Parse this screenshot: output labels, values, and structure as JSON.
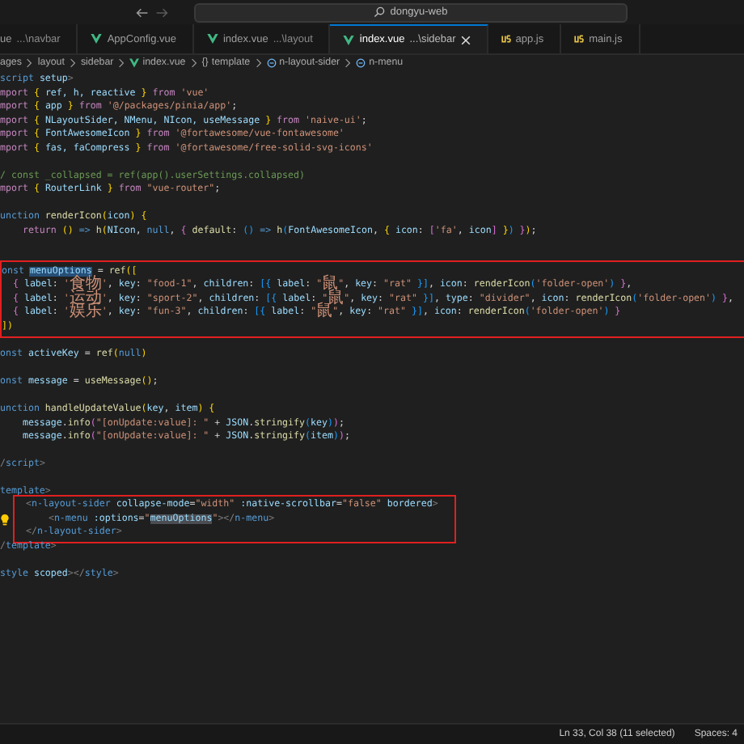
{
  "titlebar": {
    "search": "dongyu-web"
  },
  "tabs": [
    {
      "label": "ue",
      "detail": "...\\navbar",
      "kind": "plain",
      "selected": false
    },
    {
      "label": "AppConfig.vue",
      "kind": "vue",
      "selected": false
    },
    {
      "label": "index.vue",
      "detail": "...\\layout",
      "kind": "vue",
      "selected": false
    },
    {
      "label": "index.vue",
      "detail": "...\\sidebar",
      "kind": "vue",
      "selected": true
    },
    {
      "label": "app.js",
      "kind": "js",
      "selected": false
    },
    {
      "label": "main.js",
      "kind": "js",
      "selected": false
    }
  ],
  "breadcrumb": [
    {
      "kind": "plain",
      "text": "ages"
    },
    {
      "kind": "plain",
      "text": "layout"
    },
    {
      "kind": "plain",
      "text": "sidebar"
    },
    {
      "kind": "vue",
      "text": "index.vue"
    },
    {
      "kind": "braces",
      "glyph": "{}",
      "text": "template"
    },
    {
      "kind": "component",
      "text": "n-layout-sider"
    },
    {
      "kind": "component",
      "text": "n-menu"
    }
  ],
  "code": [
    {
      "lines": [
        {
          "kind": "code",
          "parts": [
            {
              "kind": "k",
              "text": "script "
            },
            {
              "kind": "v",
              "text": "setup"
            },
            {
              "kind": "t",
              "text": ">"
            }
          ]
        },
        {
          "kind": "code",
          "parts": [
            {
              "kind": "m",
              "text": "mport "
            },
            {
              "kind": "b",
              "text": "{ "
            },
            {
              "kind": "v",
              "text": "ref, h, reactive "
            },
            {
              "kind": "b",
              "text": "} "
            },
            {
              "kind": "m",
              "text": "from "
            },
            {
              "kind": "s",
              "text": "'vue'"
            }
          ]
        },
        {
          "kind": "code",
          "parts": [
            {
              "kind": "m",
              "text": "mport "
            },
            {
              "kind": "b",
              "text": "{ "
            },
            {
              "kind": "v",
              "text": "app "
            },
            {
              "kind": "b",
              "text": "} "
            },
            {
              "kind": "m",
              "text": "from "
            },
            {
              "kind": "s",
              "text": "'@/packages/pinia/app'"
            },
            {
              "kind": "p",
              "text": ";"
            }
          ]
        },
        {
          "kind": "code",
          "parts": [
            {
              "kind": "m",
              "text": "mport "
            },
            {
              "kind": "b",
              "text": "{ "
            },
            {
              "kind": "v",
              "text": "NLayoutSider, NMenu, NIcon, useMessage "
            },
            {
              "kind": "b",
              "text": "} "
            },
            {
              "kind": "m",
              "text": "from "
            },
            {
              "kind": "s",
              "text": "'naive-ui'"
            },
            {
              "kind": "p",
              "text": ";"
            }
          ]
        },
        {
          "kind": "code",
          "parts": [
            {
              "kind": "m",
              "text": "mport "
            },
            {
              "kind": "b",
              "text": "{ "
            },
            {
              "kind": "v",
              "text": "FontAwesomeIcon "
            },
            {
              "kind": "b",
              "text": "} "
            },
            {
              "kind": "m",
              "text": "from "
            },
            {
              "kind": "s",
              "text": "'@fortawesome/vue-fontawesome'"
            }
          ]
        },
        {
          "kind": "code",
          "parts": [
            {
              "kind": "m",
              "text": "mport "
            },
            {
              "kind": "b",
              "text": "{ "
            },
            {
              "kind": "v",
              "text": "fas, faCompress "
            },
            {
              "kind": "b",
              "text": "} "
            },
            {
              "kind": "m",
              "text": "from "
            },
            {
              "kind": "s",
              "text": "'@fortawesome/free-solid-svg-icons'"
            }
          ]
        },
        {
          "kind": "blank"
        },
        {
          "kind": "code",
          "parts": [
            {
              "kind": "c",
              "text": "/ const _collapsed = ref(app().userSettings.collapsed)"
            }
          ]
        },
        {
          "kind": "code",
          "parts": [
            {
              "kind": "m",
              "text": "mport "
            },
            {
              "kind": "b",
              "text": "{ "
            },
            {
              "kind": "v",
              "text": "RouterLink "
            },
            {
              "kind": "b",
              "text": "} "
            },
            {
              "kind": "m",
              "text": "from "
            },
            {
              "kind": "s",
              "text": "\"vue-router\""
            },
            {
              "kind": "p",
              "text": ";"
            }
          ]
        },
        {
          "kind": "blank"
        },
        {
          "kind": "code",
          "parts": [
            {
              "kind": "k",
              "text": "unction "
            },
            {
              "kind": "f",
              "text": "renderIcon"
            },
            {
              "kind": "b",
              "text": "("
            },
            {
              "kind": "v",
              "text": "icon"
            },
            {
              "kind": "b",
              "text": ") {"
            }
          ]
        },
        {
          "kind": "code",
          "parts": [
            {
              "kind": "m",
              "text": "    return "
            },
            {
              "kind": "b",
              "text": "() "
            },
            {
              "kind": "k",
              "text": "=> "
            },
            {
              "kind": "f",
              "text": "h"
            },
            {
              "kind": "b",
              "text": "("
            },
            {
              "kind": "v",
              "text": "NIcon"
            },
            {
              "kind": "p",
              "text": ", "
            },
            {
              "kind": "k",
              "text": "null"
            },
            {
              "kind": "p",
              "text": ", "
            },
            {
              "kind": "b2",
              "text": "{ "
            },
            {
              "kind": "f",
              "text": "default"
            },
            {
              "kind": "p",
              "text": ": "
            },
            {
              "kind": "b3",
              "text": "() "
            },
            {
              "kind": "k",
              "text": "=> "
            },
            {
              "kind": "f",
              "text": "h"
            },
            {
              "kind": "b3",
              "text": "("
            },
            {
              "kind": "v",
              "text": "FontAwesomeIcon"
            },
            {
              "kind": "p",
              "text": ", "
            },
            {
              "kind": "b",
              "text": "{ "
            },
            {
              "kind": "v",
              "text": "icon"
            },
            {
              "kind": "p",
              "text": ": "
            },
            {
              "kind": "b2",
              "text": "["
            },
            {
              "kind": "s",
              "text": "'fa'"
            },
            {
              "kind": "p",
              "text": ", "
            },
            {
              "kind": "v",
              "text": "icon"
            },
            {
              "kind": "b2",
              "text": "]"
            },
            {
              "kind": "b",
              "text": " }"
            },
            {
              "kind": "b3",
              "text": ")"
            },
            {
              "kind": "b2",
              "text": " }"
            },
            {
              "kind": "b",
              "text": ")"
            },
            {
              "kind": "p",
              "text": ";"
            }
          ]
        },
        {
          "kind": "blank"
        },
        {
          "kind": "blank"
        }
      ]
    },
    {
      "annotated": true,
      "lines": [
        {
          "kind": "code",
          "parts": [
            {
              "kind": "k",
              "text": "onst "
            },
            {
              "kind": "sel",
              "text": "menuOptions"
            },
            {
              "kind": "p",
              "text": " = "
            },
            {
              "kind": "f",
              "text": "ref"
            },
            {
              "kind": "b",
              "text": "(["
            }
          ]
        },
        {
          "kind": "code",
          "parts": [
            {
              "kind": "b2",
              "text": "  { "
            },
            {
              "kind": "v",
              "text": "label"
            },
            {
              "kind": "p",
              "text": ": "
            },
            {
              "kind": "s",
              "text": "'"
            },
            {
              "kind": "sc",
              "text": "食物"
            },
            {
              "kind": "s",
              "text": "'"
            },
            {
              "kind": "p",
              "text": ", "
            },
            {
              "kind": "v",
              "text": "key"
            },
            {
              "kind": "p",
              "text": ": "
            },
            {
              "kind": "s",
              "text": "\"food-1\""
            },
            {
              "kind": "p",
              "text": ", "
            },
            {
              "kind": "v",
              "text": "children"
            },
            {
              "kind": "p",
              "text": ": "
            },
            {
              "kind": "b3",
              "text": "[{ "
            },
            {
              "kind": "v",
              "text": "label"
            },
            {
              "kind": "p",
              "text": ": "
            },
            {
              "kind": "s",
              "text": "\""
            },
            {
              "kind": "sc",
              "text": "鼠"
            },
            {
              "kind": "s",
              "text": "\""
            },
            {
              "kind": "p",
              "text": ", "
            },
            {
              "kind": "v",
              "text": "key"
            },
            {
              "kind": "p",
              "text": ": "
            },
            {
              "kind": "s",
              "text": "\"rat\""
            },
            {
              "kind": "b3",
              "text": " }]"
            },
            {
              "kind": "p",
              "text": ", "
            },
            {
              "kind": "v",
              "text": "icon"
            },
            {
              "kind": "p",
              "text": ": "
            },
            {
              "kind": "f",
              "text": "renderIcon"
            },
            {
              "kind": "b3",
              "text": "("
            },
            {
              "kind": "s",
              "text": "'folder-open'"
            },
            {
              "kind": "b3",
              "text": ")"
            },
            {
              "kind": "b2",
              "text": " }"
            },
            {
              "kind": "p",
              "text": ","
            }
          ]
        },
        {
          "kind": "code",
          "parts": [
            {
              "kind": "b2",
              "text": "  { "
            },
            {
              "kind": "v",
              "text": "label"
            },
            {
              "kind": "p",
              "text": ": "
            },
            {
              "kind": "s",
              "text": "'"
            },
            {
              "kind": "sc",
              "text": "运动"
            },
            {
              "kind": "s",
              "text": "'"
            },
            {
              "kind": "p",
              "text": ", "
            },
            {
              "kind": "v",
              "text": "key"
            },
            {
              "kind": "p",
              "text": ": "
            },
            {
              "kind": "s",
              "text": "\"sport-2\""
            },
            {
              "kind": "p",
              "text": ", "
            },
            {
              "kind": "v",
              "text": "children"
            },
            {
              "kind": "p",
              "text": ": "
            },
            {
              "kind": "b3",
              "text": "[{ "
            },
            {
              "kind": "v",
              "text": "label"
            },
            {
              "kind": "p",
              "text": ": "
            },
            {
              "kind": "s",
              "text": "\""
            },
            {
              "kind": "sc",
              "text": "鼠"
            },
            {
              "kind": "s",
              "text": "\""
            },
            {
              "kind": "p",
              "text": ", "
            },
            {
              "kind": "v",
              "text": "key"
            },
            {
              "kind": "p",
              "text": ": "
            },
            {
              "kind": "s",
              "text": "\"rat\""
            },
            {
              "kind": "b3",
              "text": " }]"
            },
            {
              "kind": "p",
              "text": ", "
            },
            {
              "kind": "v",
              "text": "type"
            },
            {
              "kind": "p",
              "text": ": "
            },
            {
              "kind": "s",
              "text": "\"divider\""
            },
            {
              "kind": "p",
              "text": ", "
            },
            {
              "kind": "v",
              "text": "icon"
            },
            {
              "kind": "p",
              "text": ": "
            },
            {
              "kind": "f",
              "text": "renderIcon"
            },
            {
              "kind": "b3",
              "text": "("
            },
            {
              "kind": "s",
              "text": "'folder-open'"
            },
            {
              "kind": "b3",
              "text": ")"
            },
            {
              "kind": "b2",
              "text": " }"
            },
            {
              "kind": "p",
              "text": ","
            }
          ]
        },
        {
          "kind": "code",
          "parts": [
            {
              "kind": "b2",
              "text": "  { "
            },
            {
              "kind": "v",
              "text": "label"
            },
            {
              "kind": "p",
              "text": ": "
            },
            {
              "kind": "s",
              "text": "'"
            },
            {
              "kind": "sc",
              "text": "娱乐"
            },
            {
              "kind": "s",
              "text": "'"
            },
            {
              "kind": "p",
              "text": ", "
            },
            {
              "kind": "v",
              "text": "key"
            },
            {
              "kind": "p",
              "text": ": "
            },
            {
              "kind": "s",
              "text": "\"fun-3\""
            },
            {
              "kind": "p",
              "text": ", "
            },
            {
              "kind": "v",
              "text": "children"
            },
            {
              "kind": "p",
              "text": ": "
            },
            {
              "kind": "b3",
              "text": "[{ "
            },
            {
              "kind": "v",
              "text": "label"
            },
            {
              "kind": "p",
              "text": ": "
            },
            {
              "kind": "s",
              "text": "\""
            },
            {
              "kind": "sc",
              "text": "鼠"
            },
            {
              "kind": "s",
              "text": "\""
            },
            {
              "kind": "p",
              "text": ", "
            },
            {
              "kind": "v",
              "text": "key"
            },
            {
              "kind": "p",
              "text": ": "
            },
            {
              "kind": "s",
              "text": "\"rat\""
            },
            {
              "kind": "b3",
              "text": " }]"
            },
            {
              "kind": "p",
              "text": ", "
            },
            {
              "kind": "v",
              "text": "icon"
            },
            {
              "kind": "p",
              "text": ": "
            },
            {
              "kind": "f",
              "text": "renderIcon"
            },
            {
              "kind": "b3",
              "text": "("
            },
            {
              "kind": "s",
              "text": "'folder-open'"
            },
            {
              "kind": "b3",
              "text": ")"
            },
            {
              "kind": "b2",
              "text": " }"
            }
          ]
        },
        {
          "kind": "code",
          "parts": [
            {
              "kind": "b",
              "text": "])"
            }
          ]
        }
      ]
    },
    {
      "lines": [
        {
          "kind": "blank"
        },
        {
          "kind": "code",
          "parts": [
            {
              "kind": "k",
              "text": "onst "
            },
            {
              "kind": "v",
              "text": "activeKey"
            },
            {
              "kind": "p",
              "text": " = "
            },
            {
              "kind": "f",
              "text": "ref"
            },
            {
              "kind": "b",
              "text": "("
            },
            {
              "kind": "k",
              "text": "null"
            },
            {
              "kind": "b",
              "text": ")"
            }
          ]
        },
        {
          "kind": "blank"
        },
        {
          "kind": "code",
          "parts": [
            {
              "kind": "k",
              "text": "onst "
            },
            {
              "kind": "v",
              "text": "message"
            },
            {
              "kind": "p",
              "text": " = "
            },
            {
              "kind": "f",
              "text": "useMessage"
            },
            {
              "kind": "b",
              "text": "()"
            },
            {
              "kind": "p",
              "text": ";"
            }
          ]
        },
        {
          "kind": "blank"
        },
        {
          "kind": "code",
          "parts": [
            {
              "kind": "k",
              "text": "unction "
            },
            {
              "kind": "f",
              "text": "handleUpdateValue"
            },
            {
              "kind": "b",
              "text": "("
            },
            {
              "kind": "v",
              "text": "key"
            },
            {
              "kind": "p",
              "text": ", "
            },
            {
              "kind": "v",
              "text": "item"
            },
            {
              "kind": "b",
              "text": ") {"
            }
          ]
        },
        {
          "kind": "code",
          "parts": [
            {
              "kind": "v",
              "text": "    message"
            },
            {
              "kind": "p",
              "text": "."
            },
            {
              "kind": "f",
              "text": "info"
            },
            {
              "kind": "b2",
              "text": "("
            },
            {
              "kind": "s",
              "text": "\"[onUpdate:value]: \""
            },
            {
              "kind": "p",
              "text": " + "
            },
            {
              "kind": "v",
              "text": "JSON"
            },
            {
              "kind": "p",
              "text": "."
            },
            {
              "kind": "f",
              "text": "stringify"
            },
            {
              "kind": "b3",
              "text": "("
            },
            {
              "kind": "v",
              "text": "key"
            },
            {
              "kind": "b3",
              "text": ")"
            },
            {
              "kind": "b2",
              "text": ")"
            },
            {
              "kind": "p",
              "text": ";"
            }
          ]
        },
        {
          "kind": "code",
          "parts": [
            {
              "kind": "v",
              "text": "    message"
            },
            {
              "kind": "p",
              "text": "."
            },
            {
              "kind": "f",
              "text": "info"
            },
            {
              "kind": "b2",
              "text": "("
            },
            {
              "kind": "s",
              "text": "\"[onUpdate:value]: \""
            },
            {
              "kind": "p",
              "text": " + "
            },
            {
              "kind": "v",
              "text": "JSON"
            },
            {
              "kind": "p",
              "text": "."
            },
            {
              "kind": "f",
              "text": "stringify"
            },
            {
              "kind": "b3",
              "text": "("
            },
            {
              "kind": "v",
              "text": "item"
            },
            {
              "kind": "b3",
              "text": ")"
            },
            {
              "kind": "b2",
              "text": ")"
            },
            {
              "kind": "p",
              "text": ";"
            }
          ]
        },
        {
          "kind": "blank"
        },
        {
          "kind": "code",
          "parts": [
            {
              "kind": "t",
              "text": "/"
            },
            {
              "kind": "k",
              "text": "script"
            },
            {
              "kind": "t",
              "text": ">"
            }
          ]
        },
        {
          "kind": "blank"
        },
        {
          "kind": "code",
          "parts": [
            {
              "kind": "k",
              "text": "template"
            },
            {
              "kind": "t",
              "text": ">"
            }
          ]
        }
      ]
    },
    {
      "annotated": true,
      "lines": [
        {
          "kind": "code",
          "parts": [
            {
              "kind": "t",
              "text": "  <"
            },
            {
              "kind": "k",
              "text": "n-layout-sider"
            },
            {
              "kind": "v",
              "text": " collapse-mode"
            },
            {
              "kind": "p",
              "text": "="
            },
            {
              "kind": "s",
              "text": "\"width\""
            },
            {
              "kind": "v",
              "text": " :native-scrollbar"
            },
            {
              "kind": "p",
              "text": "="
            },
            {
              "kind": "s",
              "text": "\"false\""
            },
            {
              "kind": "v",
              "text": " bordered"
            },
            {
              "kind": "t",
              "text": ">"
            }
          ]
        },
        {
          "kind": "code",
          "lightbulb": true,
          "parts": [
            {
              "kind": "t",
              "text": "      <"
            },
            {
              "kind": "k",
              "text": "n-menu"
            },
            {
              "kind": "v",
              "text": " :options"
            },
            {
              "kind": "p",
              "text": "="
            },
            {
              "kind": "s",
              "text": "\""
            },
            {
              "kind": "hl",
              "text": "menuOptions"
            },
            {
              "kind": "s",
              "text": "\""
            },
            {
              "kind": "t",
              "text": "></"
            },
            {
              "kind": "k",
              "text": "n-menu"
            },
            {
              "kind": "t",
              "text": ">"
            }
          ]
        },
        {
          "kind": "code",
          "parts": [
            {
              "kind": "t",
              "text": "  </"
            },
            {
              "kind": "k",
              "text": "n-layout-sider"
            },
            {
              "kind": "t",
              "text": ">"
            }
          ]
        }
      ]
    },
    {
      "lines": [
        {
          "kind": "code",
          "parts": [
            {
              "kind": "t",
              "text": "/"
            },
            {
              "kind": "k",
              "text": "template"
            },
            {
              "kind": "t",
              "text": ">"
            }
          ]
        },
        {
          "kind": "blank"
        },
        {
          "kind": "code",
          "parts": [
            {
              "kind": "k",
              "text": "style "
            },
            {
              "kind": "v",
              "text": "scoped"
            },
            {
              "kind": "t",
              "text": "></"
            },
            {
              "kind": "k",
              "text": "style"
            },
            {
              "kind": "t",
              "text": ">"
            }
          ]
        }
      ]
    }
  ],
  "status_bar": {
    "position": "Ln 33, Col 38 (11 selected)",
    "indent": "Spaces: 4"
  }
}
